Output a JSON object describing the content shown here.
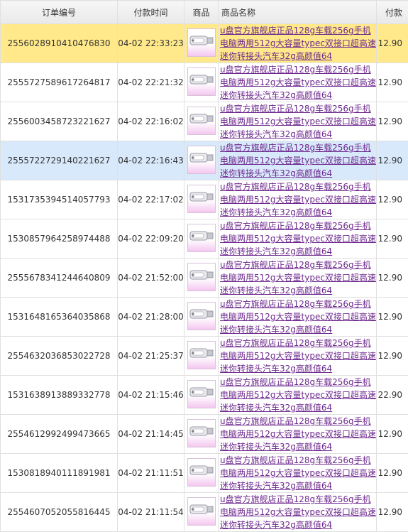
{
  "headers": {
    "order_id": "订单编号",
    "pay_time": "付款时间",
    "product": "商品",
    "product_name": "商品名称",
    "payment": "付款"
  },
  "product_title": "u盘官方旗舰店正品128g车载256g手机电脑两用512g大容量typec双接口超高速迷你转接头汽车32g高颜值64",
  "rows": [
    {
      "order_id": "2556028910410476830",
      "time": "04-02 22:33:23",
      "amount": "12.90",
      "highlight": "yellow"
    },
    {
      "order_id": "2555727589617264817",
      "time": "04-02 22:21:32",
      "amount": "12.90",
      "highlight": ""
    },
    {
      "order_id": "2556003458723221627",
      "time": "04-02 22:16:02",
      "amount": "12.90",
      "highlight": ""
    },
    {
      "order_id": "2555722729140221627",
      "time": "04-02 22:16:43",
      "amount": "12.90",
      "highlight": "blue"
    },
    {
      "order_id": "1531735394514057793",
      "time": "04-02 22:17:02",
      "amount": "12.90",
      "highlight": ""
    },
    {
      "order_id": "1530857964258974488",
      "time": "04-02 22:09:20",
      "amount": "12.90",
      "highlight": ""
    },
    {
      "order_id": "2555678341244640809",
      "time": "04-02 21:52:00",
      "amount": "12.90",
      "highlight": ""
    },
    {
      "order_id": "1531648165364035868",
      "time": "04-02 21:28:00",
      "amount": "12.90",
      "highlight": ""
    },
    {
      "order_id": "2554632036853022728",
      "time": "04-02 21:25:37",
      "amount": "12.90",
      "highlight": ""
    },
    {
      "order_id": "1531638913889332778",
      "time": "04-02 21:15:46",
      "amount": "22.90",
      "highlight": ""
    },
    {
      "order_id": "2554612992499473665",
      "time": "04-02 21:14:45",
      "amount": "12.90",
      "highlight": ""
    },
    {
      "order_id": "1530818940111891981",
      "time": "04-02 21:11:51",
      "amount": "12.90",
      "highlight": ""
    },
    {
      "order_id": "2554607052055816445",
      "time": "04-02 21:11:54",
      "amount": "12.90",
      "highlight": ""
    }
  ],
  "icons": {
    "product_thumbnail": "usb-flash-drive-icon"
  },
  "colors": {
    "highlight_yellow": "#ffe98a",
    "highlight_blue": "#d8e9fb",
    "link": "#6e2a8e"
  }
}
